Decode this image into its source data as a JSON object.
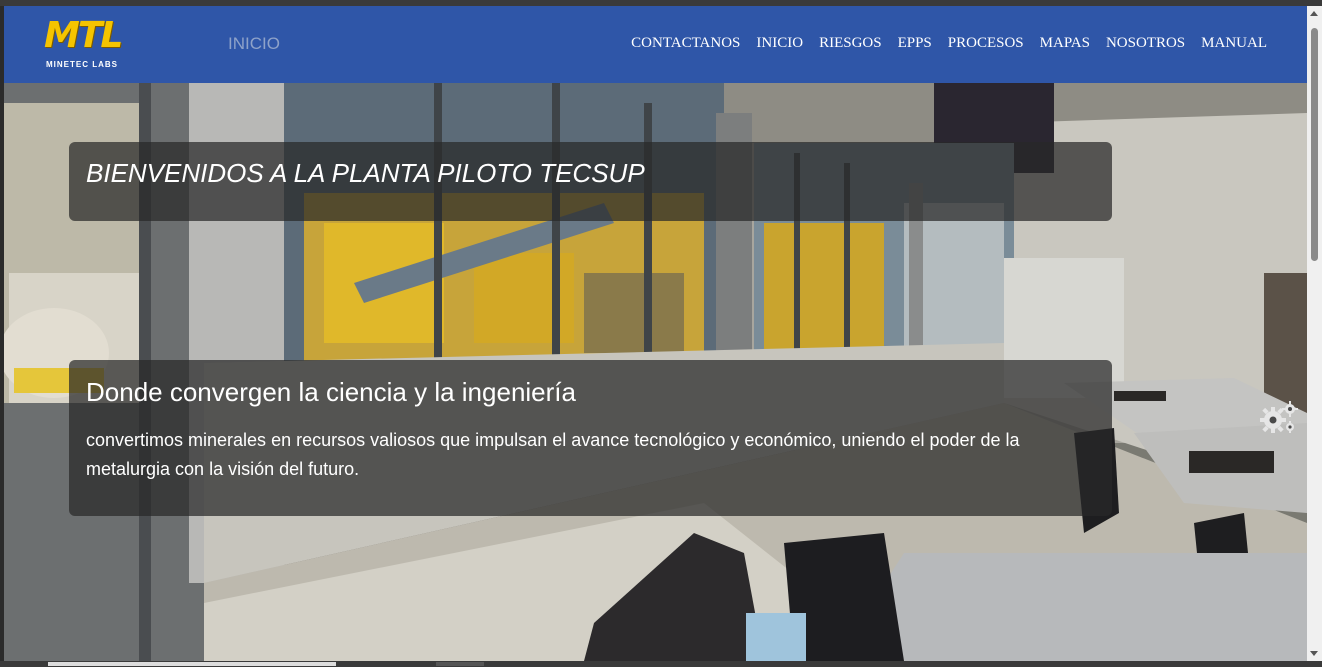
{
  "header": {
    "logo_text": "MTL",
    "logo_subtitle": "MINETEC LABS",
    "page_label": "INICIO",
    "nav": [
      "CONTACTANOS",
      "INICIO",
      "RIESGOS",
      "EPPS",
      "PROCESOS",
      "MAPAS",
      "NOSOTROS",
      "MANUAL"
    ]
  },
  "hero": {
    "title": "BIENVENIDOS A LA PLANTA PILOTO TECSUP",
    "heading": "Donde convergen la ciencia y la ingeniería",
    "text": "convertimos minerales en recursos valiosos que impulsan el avance tecnológico y económico, uniendo el poder de la metalurgia con la visión del futuro."
  },
  "icons": {
    "settings": "gears-icon"
  },
  "colors": {
    "navbar": "#2f56a8",
    "logo": "#f5c400",
    "overlay": "rgba(40,40,40,0.72)"
  }
}
